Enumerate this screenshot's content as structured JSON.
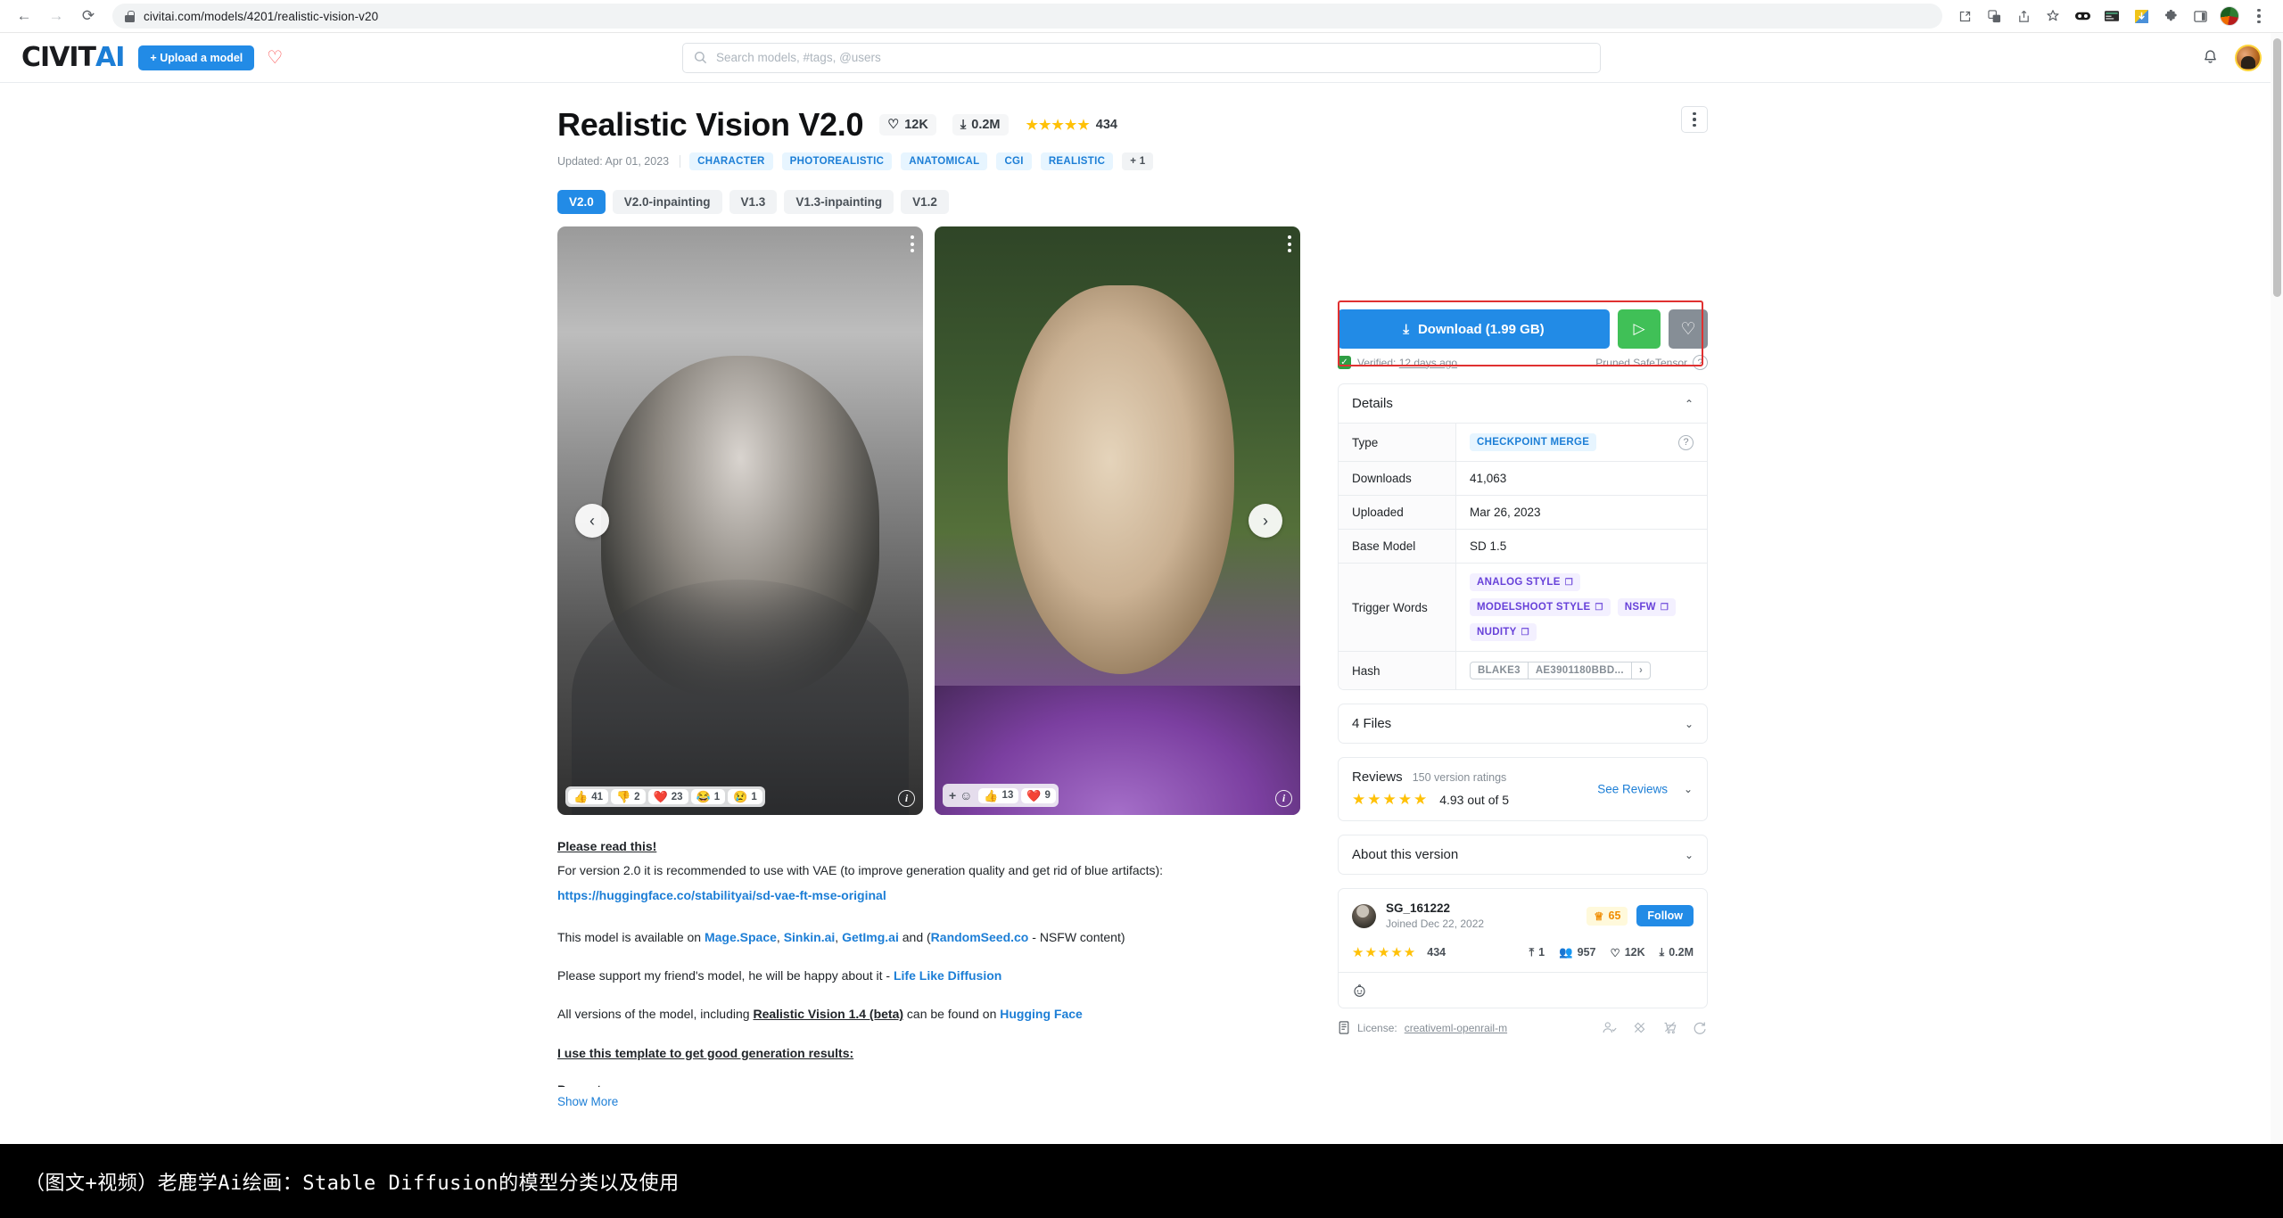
{
  "browser": {
    "url": "civitai.com/models/4201/realistic-vision-v20",
    "nav": {
      "back": "←",
      "forward": "→",
      "reload": "⟳"
    },
    "toolbar_icons": [
      "install-icon",
      "translate-icon",
      "share-icon",
      "bookmark-star-icon",
      "extension-goggles-icon",
      "extension-card-icon",
      "extension-download-icon",
      "extensions-puzzle-icon",
      "sidepanel-icon",
      "profile-avatar-icon",
      "chrome-menu-icon"
    ]
  },
  "header": {
    "logo_dark": "CIVIT",
    "logo_blue": "AI",
    "upload_label": "+ Upload a model",
    "heart_icon": "♡",
    "search_placeholder": "Search models, #tags, @users",
    "bell_icon": "🔔"
  },
  "model": {
    "title": "Realistic Vision V2.0",
    "likes": "12K",
    "downloads_short": "0.2M",
    "rating_count": "434",
    "stars": "★★★★★",
    "updated": "Updated: Apr 01, 2023",
    "tags": [
      "CHARACTER",
      "PHOTOREALISTIC",
      "ANATOMICAL",
      "CGI",
      "REALISTIC"
    ],
    "tag_more": "+ 1",
    "versions": [
      "V2.0",
      "V2.0-inpainting",
      "V1.3",
      "V1.3-inpainting",
      "V1.2"
    ],
    "active_version": "V2.0"
  },
  "gallery": {
    "prev_arrow": "‹",
    "next_arrow": "›",
    "image1_reactions": [
      {
        "emoji": "👍",
        "count": "41"
      },
      {
        "emoji": "👎",
        "count": "2"
      },
      {
        "emoji": "❤️",
        "count": "23"
      },
      {
        "emoji": "😂",
        "count": "1"
      },
      {
        "emoji": "😢",
        "count": "1"
      }
    ],
    "image2_add": "+ ☺",
    "image2_reactions": [
      {
        "emoji": "👍",
        "count": "13"
      },
      {
        "emoji": "❤️",
        "count": "9"
      }
    ],
    "info_badge": "i"
  },
  "description": {
    "heading": "Please read this!",
    "line_vae": "For version 2.0 it is recommended to use with VAE (to improve generation quality and get rid of blue artifacts):",
    "vae_link": "https://huggingface.co/stabilityai/sd-vae-ft-mse-original",
    "avail_pre": "This model is available on ",
    "avail_links": [
      "Mage.Space",
      "Sinkin.ai",
      "GetImg.ai",
      "RandomSeed.co"
    ],
    "avail_mid": " and (",
    "avail_post": " - NSFW content)",
    "support_pre": "Please support my friend's model, he will be happy about it - ",
    "support_link": "Life Like Diffusion",
    "versions_pre": "All versions of the model, including ",
    "versions_bold": "Realistic Vision 1.4 (beta)",
    "versions_mid": " can be found on ",
    "versions_link": "Hugging Face",
    "template_heading": "I use this template to get good generation results:",
    "prompt_label": "Prompt:",
    "show_more": "Show More"
  },
  "sidebar": {
    "download_label": "Download (1.99 GB)",
    "download_icon": "⤓",
    "run_icon": "▷",
    "fav_icon": "♡",
    "verified_text": "Verified:",
    "verified_time": "12 days ago",
    "file_format": "Pruned SafeTensor",
    "details": {
      "title": "Details",
      "rows": [
        {
          "key": "Type",
          "value": "CHECKPOINT MERGE",
          "kind": "badge"
        },
        {
          "key": "Downloads",
          "value": "41,063",
          "kind": "text"
        },
        {
          "key": "Uploaded",
          "value": "Mar 26, 2023",
          "kind": "text"
        },
        {
          "key": "Base Model",
          "value": "SD 1.5",
          "kind": "text"
        }
      ],
      "trigger_key": "Trigger Words",
      "trigger_words": [
        "ANALOG STYLE",
        "MODELSHOOT STYLE",
        "NSFW",
        "NUDITY"
      ],
      "hash_key": "Hash",
      "hash_algo": "BLAKE3",
      "hash_value": "AE3901180BBD...",
      "hash_expand": "›"
    },
    "files": {
      "title": "4 Files"
    },
    "reviews": {
      "label": "Reviews",
      "sub": "150 version ratings",
      "stars": "★★★★★",
      "score": "4.93 out of 5",
      "see_reviews": "See Reviews"
    },
    "about": {
      "title": "About this version"
    },
    "creator": {
      "name": "SG_161222",
      "joined": "Joined Dec 22, 2022",
      "crown_count": "65",
      "follow": "Follow",
      "stars": "★★★★★",
      "rating_count": "434",
      "uploads": "1",
      "followers": "957",
      "likes": "12K",
      "downloads": "0.2M",
      "social_icon": "reddit-icon"
    },
    "license": {
      "prefix": "License:",
      "name": "creativeml-openrail-m",
      "permission_icons": [
        "credit-required-icon",
        "no-sell-images-icon",
        "no-sell-model-icon",
        "share-merges-icon"
      ]
    }
  },
  "caption": {
    "text": "（图文+视频）老鹿学Ai绘画：Stable Diffusion的模型分类以及使用"
  }
}
